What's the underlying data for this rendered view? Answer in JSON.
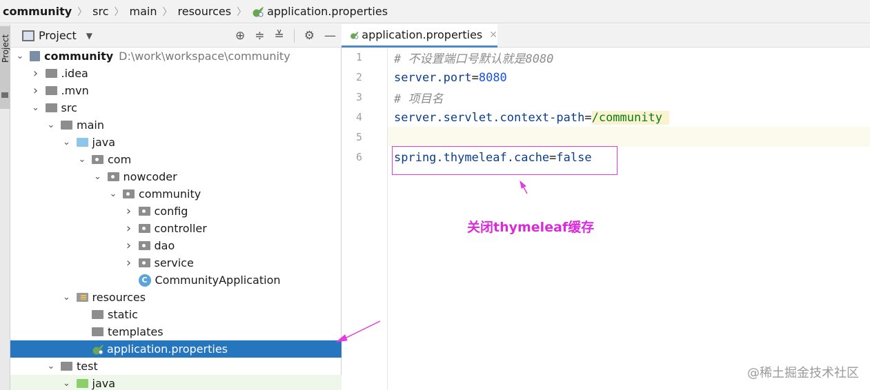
{
  "breadcrumb": [
    "community",
    "src",
    "main",
    "resources",
    "application.properties"
  ],
  "tool_strip": {
    "label": "Project"
  },
  "project_panel": {
    "title": "Project",
    "dropdown_icon": "chevron-down-icon",
    "actions": [
      "locate-icon",
      "expand-all-icon",
      "collapse-all-icon",
      "gear-icon",
      "minimize-icon"
    ]
  },
  "tree": [
    {
      "label": "community",
      "path": "D:\\work\\workspace\\community",
      "depth": 0,
      "expanded": true,
      "icon": "module"
    },
    {
      "label": ".idea",
      "depth": 1,
      "expanded": false,
      "icon": "folder"
    },
    {
      "label": ".mvn",
      "depth": 1,
      "expanded": false,
      "icon": "folder"
    },
    {
      "label": "src",
      "depth": 1,
      "expanded": true,
      "icon": "folder"
    },
    {
      "label": "main",
      "depth": 2,
      "expanded": true,
      "icon": "folder"
    },
    {
      "label": "java",
      "depth": 3,
      "expanded": true,
      "icon": "source-folder"
    },
    {
      "label": "com",
      "depth": 4,
      "expanded": true,
      "icon": "package"
    },
    {
      "label": "nowcoder",
      "depth": 5,
      "expanded": true,
      "icon": "package"
    },
    {
      "label": "community",
      "depth": 6,
      "expanded": true,
      "icon": "package"
    },
    {
      "label": "config",
      "depth": 7,
      "expanded": false,
      "icon": "package"
    },
    {
      "label": "controller",
      "depth": 7,
      "expanded": false,
      "icon": "package"
    },
    {
      "label": "dao",
      "depth": 7,
      "expanded": false,
      "icon": "package"
    },
    {
      "label": "service",
      "depth": 7,
      "expanded": false,
      "icon": "package"
    },
    {
      "label": "CommunityApplication",
      "depth": 7,
      "expanded": null,
      "icon": "spring-class"
    },
    {
      "label": "resources",
      "depth": 3,
      "expanded": true,
      "icon": "resources-folder"
    },
    {
      "label": "static",
      "depth": 4,
      "expanded": null,
      "icon": "folder"
    },
    {
      "label": "templates",
      "depth": 4,
      "expanded": null,
      "icon": "folder"
    },
    {
      "label": "application.properties",
      "depth": 4,
      "expanded": null,
      "icon": "spring-properties",
      "selected": true
    },
    {
      "label": "test",
      "depth": 2,
      "expanded": true,
      "icon": "folder"
    },
    {
      "label": "java",
      "depth": 3,
      "expanded": true,
      "icon": "test-folder"
    }
  ],
  "editor": {
    "tab_label": "application.properties",
    "lines": [
      {
        "num": "1",
        "parts": [
          {
            "t": "# 不设置端口号默认就是8080",
            "c": "c-comment"
          }
        ]
      },
      {
        "num": "2",
        "parts": [
          {
            "t": "server.port",
            "c": "c-key"
          },
          {
            "t": "=",
            "c": "c-eq"
          },
          {
            "t": "8080",
            "c": "c-num"
          }
        ]
      },
      {
        "num": "3",
        "parts": [
          {
            "t": "# 项目名",
            "c": "c-comment"
          }
        ]
      },
      {
        "num": "4",
        "parts": [
          {
            "t": "server.servlet.context-path",
            "c": "c-key"
          },
          {
            "t": "=",
            "c": "c-eq"
          },
          {
            "t": "/community",
            "c": "c-val caret-hl"
          }
        ]
      },
      {
        "num": "5",
        "parts": []
      },
      {
        "num": "6",
        "parts": [
          {
            "t": "spring.thymeleaf.cache",
            "c": "c-key"
          },
          {
            "t": "=",
            "c": "c-eq"
          },
          {
            "t": "false",
            "c": "c-bool"
          }
        ]
      }
    ]
  },
  "annotation": {
    "text": "关闭thymeleaf缓存",
    "color": "#d92bd9"
  },
  "watermark": "@稀土掘金技术社区",
  "colors": {
    "selection": "#2675bf",
    "accent_tab": "#4a88c7"
  }
}
